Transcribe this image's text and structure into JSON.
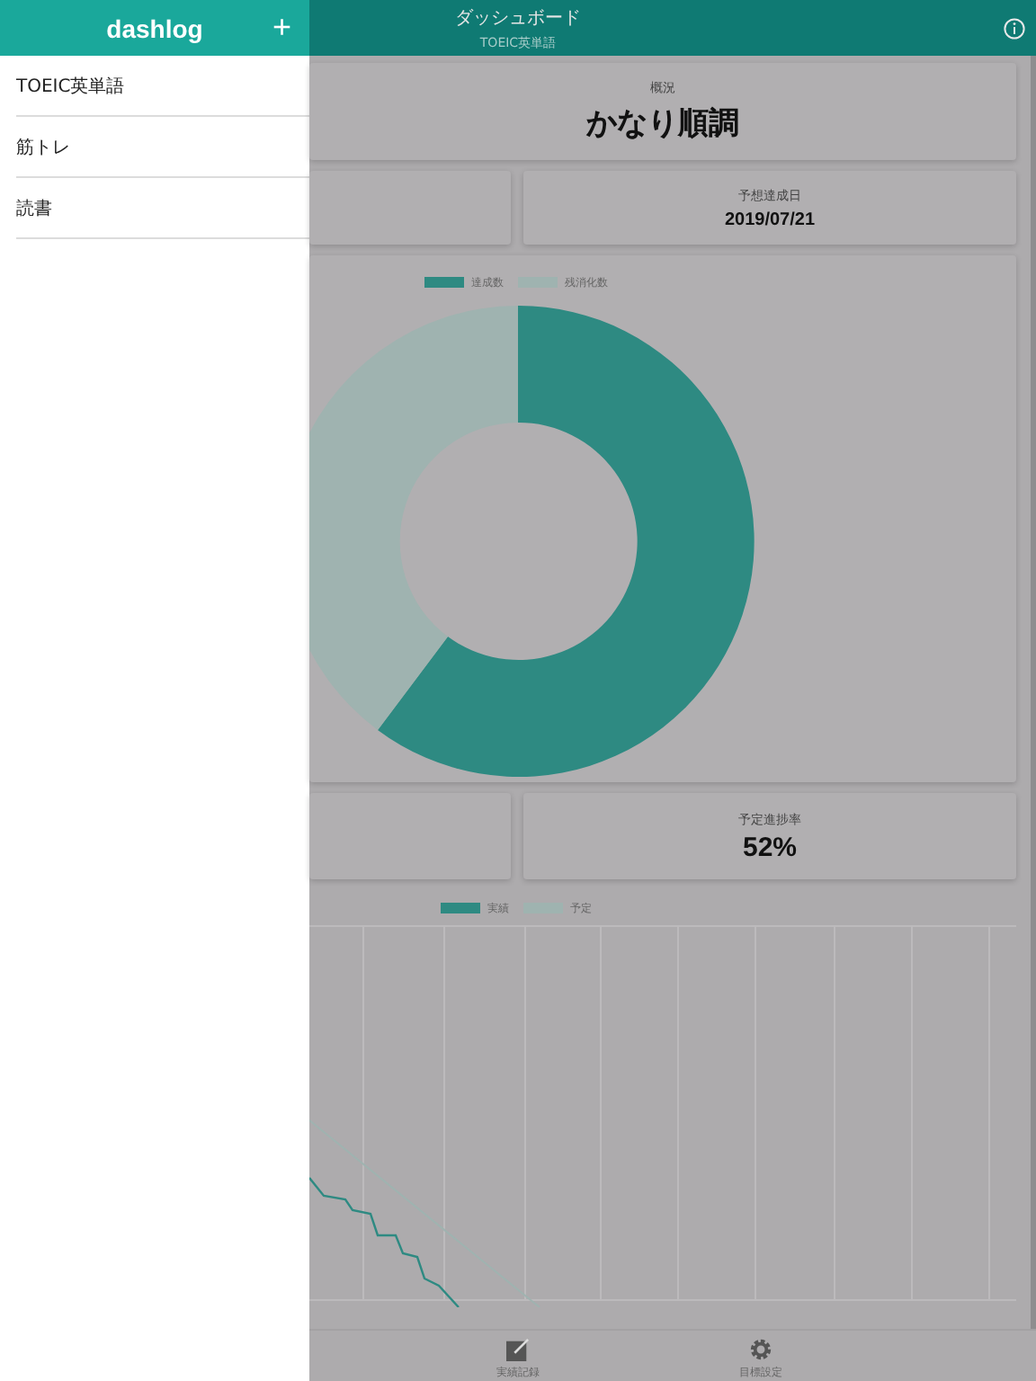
{
  "sidebar": {
    "title": "dashlog",
    "add_button": "+",
    "items": [
      {
        "label": "TOEIC英単語"
      },
      {
        "label": "筋トレ"
      },
      {
        "label": "読書"
      }
    ]
  },
  "header": {
    "title": "ダッシュボード",
    "subtitle": "TOEIC英単語"
  },
  "summary": {
    "label": "概況",
    "value": "かなり順調"
  },
  "stats_top": {
    "label": "予想達成日",
    "value": "2019/07/21"
  },
  "donut": {
    "legend": [
      {
        "label": "達成数",
        "color": "#2e8a82"
      },
      {
        "label": "残消化数",
        "color": "#9fb3b0"
      }
    ]
  },
  "stats_bottom": {
    "label": "予定進捗率",
    "value": "52%"
  },
  "line_chart": {
    "legend": [
      {
        "label": "実績",
        "color": "#2e8a82"
      },
      {
        "label": "予定",
        "color": "#9fb3b0"
      }
    ]
  },
  "tab_bar": [
    {
      "kind": "pencil",
      "label": "実績記録"
    },
    {
      "kind": "gear",
      "label": "目標設定"
    }
  ]
}
